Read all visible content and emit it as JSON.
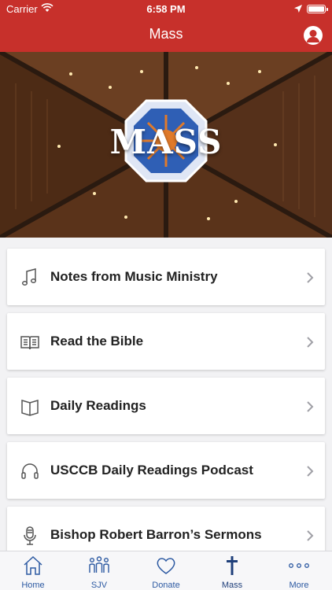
{
  "status": {
    "carrier": "Carrier",
    "time": "6:58 PM"
  },
  "nav": {
    "title": "Mass",
    "profile_icon": "profile-icon"
  },
  "hero": {
    "title": "MASS"
  },
  "items": [
    {
      "label": "Notes from Music Ministry",
      "icon": "music-note-icon"
    },
    {
      "label": "Read the Bible",
      "icon": "open-book-icon"
    },
    {
      "label": "Daily Readings",
      "icon": "book-icon"
    },
    {
      "label": "USCCB Daily Readings Podcast",
      "icon": "headphones-icon"
    },
    {
      "label": "Bishop Robert Barron’s Sermons",
      "icon": "microphone-icon"
    }
  ],
  "tabs": [
    {
      "label": "Home",
      "icon": "home-icon"
    },
    {
      "label": "SJV",
      "icon": "people-icon"
    },
    {
      "label": "Donate",
      "icon": "heart-icon"
    },
    {
      "label": "Mass",
      "icon": "cross-icon"
    },
    {
      "label": "More",
      "icon": "more-dots-icon"
    }
  ],
  "colors": {
    "brand_red": "#c7302b",
    "tab_blue": "#2d5aa2",
    "active_tab": "#1f3f7a"
  }
}
